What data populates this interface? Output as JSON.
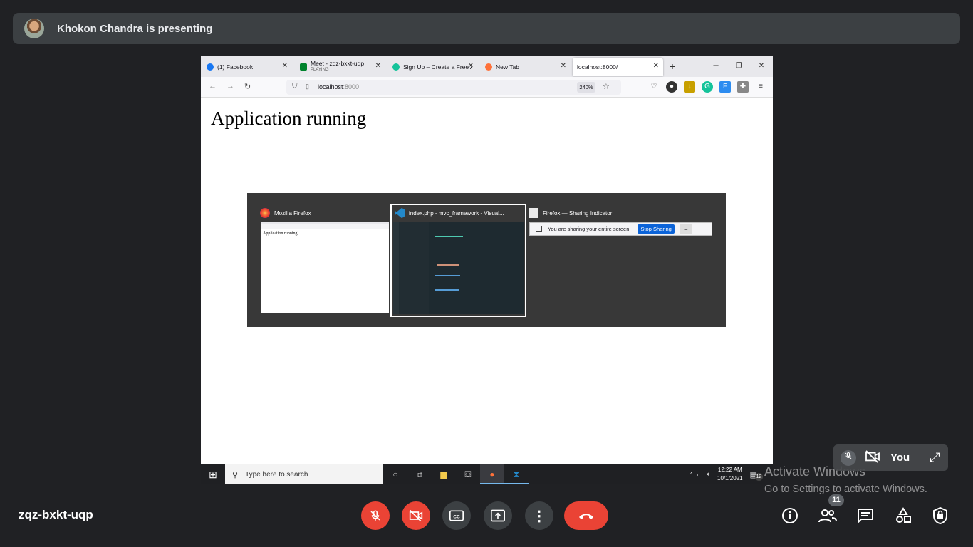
{
  "banner": {
    "presenter_text": "Khokon Chandra is presenting"
  },
  "browser": {
    "tabs": [
      {
        "title": "(1) Facebook",
        "favicon": "facebook-icon",
        "color": "#1877f2"
      },
      {
        "title": "Meet - zqz-bxkt-uqp",
        "subtitle": "PLAYING",
        "favicon": "meet-icon",
        "color": "#00832d"
      },
      {
        "title": "Sign Up – Create a Free A",
        "favicon": "grammarly-icon",
        "color": "#15c39a"
      },
      {
        "title": "New Tab",
        "favicon": "firefox-icon",
        "color": "#ff7139"
      },
      {
        "title": "localhost:8000/",
        "favicon": "",
        "color": ""
      }
    ],
    "url_host": "localhost",
    "url_port": ":8000",
    "zoom": "240%",
    "page_heading": "Application running"
  },
  "switcher": {
    "items": [
      {
        "title": "Mozilla Firefox",
        "thumb_text": "Application running"
      },
      {
        "title": "index.php - mvc_framework - Visual..."
      },
      {
        "title": "Firefox — Sharing Indicator"
      }
    ],
    "sharing_text": "You are sharing your entire screen.",
    "stop_label": "Stop Sharing"
  },
  "taskbar": {
    "search_placeholder": "Type here to search",
    "time": "12:22 AM",
    "date": "10/1/2021",
    "notifications": "12"
  },
  "watermark": {
    "line1": "Activate Windows",
    "line2": "Go to Settings to activate Windows."
  },
  "self_tile": {
    "label": "You"
  },
  "meeting": {
    "code": "zqz-bxkt-uqp",
    "participants": "11"
  },
  "colors": {
    "end_call": "#ea4335",
    "control_bg": "#3c4043",
    "background": "#202124"
  }
}
